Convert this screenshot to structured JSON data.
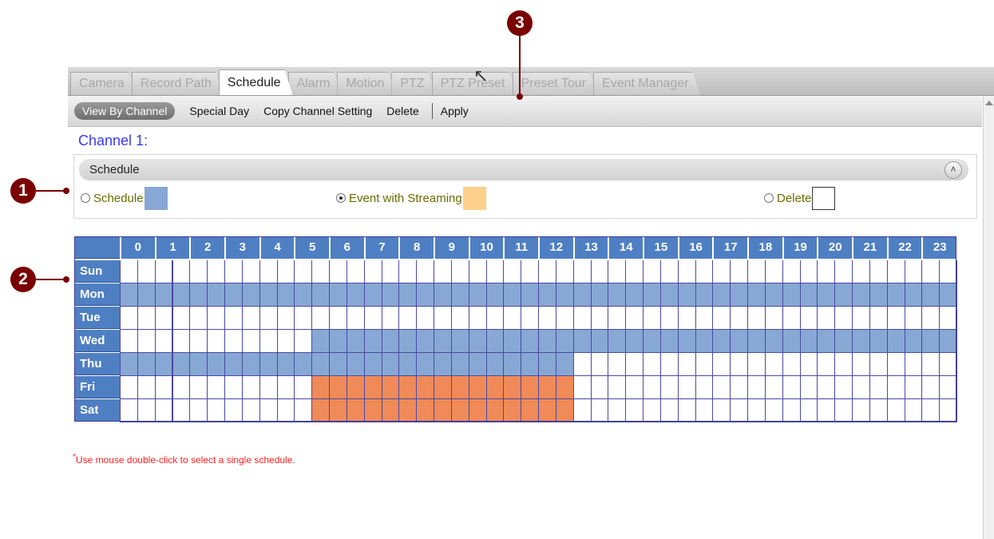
{
  "tabs": [
    "Camera",
    "Record Path",
    "Schedule",
    "Alarm",
    "Motion",
    "PTZ",
    "PTZ Preset",
    "Preset Tour",
    "Event Manager"
  ],
  "active_tab": "Schedule",
  "toolbar": {
    "view_by_channel": "View By Channel",
    "special_day": "Special Day",
    "copy_channel_setting": "Copy Channel Setting",
    "delete": "Delete",
    "apply": "Apply"
  },
  "channel_title": "Channel 1:",
  "panel": {
    "title": "Schedule",
    "collapse_icon": "double-chevron-up-icon",
    "legend": [
      {
        "label": "Schedule",
        "color": "#87a8d4",
        "selected": false
      },
      {
        "label": "Event with Streaming",
        "color": "#ffd08a",
        "selected": true
      },
      {
        "label": "Delete",
        "color": "#ffffff",
        "selected": false
      }
    ]
  },
  "grid": {
    "hours": [
      "0",
      "1",
      "2",
      "3",
      "4",
      "5",
      "6",
      "7",
      "8",
      "9",
      "10",
      "11",
      "12",
      "13",
      "14",
      "15",
      "16",
      "17",
      "18",
      "19",
      "20",
      "21",
      "22",
      "23"
    ],
    "colors": {
      "schedule": "#87a8d4",
      "event": "#f08a58",
      "empty": "#ffffff"
    },
    "days": [
      {
        "label": "Sun",
        "schedule": [],
        "event": []
      },
      {
        "label": "Mon",
        "schedule": [
          [
            0,
            24
          ]
        ],
        "event": []
      },
      {
        "label": "Tue",
        "schedule": [],
        "event": []
      },
      {
        "label": "Wed",
        "schedule": [
          [
            5.5,
            24
          ]
        ],
        "event": []
      },
      {
        "label": "Thu",
        "schedule": [
          [
            0,
            13
          ]
        ],
        "event": []
      },
      {
        "label": "Fri",
        "schedule": [],
        "event": [
          [
            5.5,
            13
          ]
        ]
      },
      {
        "label": "Sat",
        "schedule": [],
        "event": [
          [
            5.5,
            13
          ]
        ]
      }
    ]
  },
  "note": {
    "mark": "*",
    "text": "Use mouse double-click to select a single schedule."
  },
  "callouts": [
    "1",
    "2",
    "3"
  ]
}
